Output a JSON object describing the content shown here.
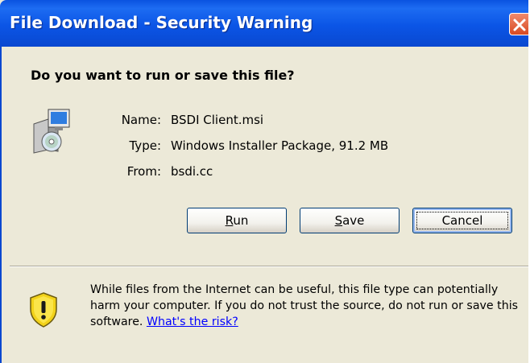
{
  "window": {
    "title": "File Download - Security Warning"
  },
  "question": "Do you want to run or save this file?",
  "file": {
    "name_label": "Name:",
    "name": "BSDI Client.msi",
    "type_label": "Type:",
    "type": "Windows Installer Package, 91.2 MB",
    "from_label": "From:",
    "from": "bsdi.cc",
    "icon": "installer-package-icon"
  },
  "buttons": {
    "run": {
      "mnemonic": "R",
      "rest": "un"
    },
    "save": {
      "mnemonic": "S",
      "rest": "ave"
    },
    "cancel": "Cancel"
  },
  "warning": {
    "icon": "shield-warning-icon",
    "text": "While files from the Internet can be useful, this file type can potentially harm your computer. If you do not trust the source, do not run or save this software.",
    "link": "What's the risk?"
  },
  "colors": {
    "titlebar": "#0a53e0",
    "dialog_bg": "#ece9d8",
    "close_button": "#d84a22",
    "link": "#0000ff"
  }
}
